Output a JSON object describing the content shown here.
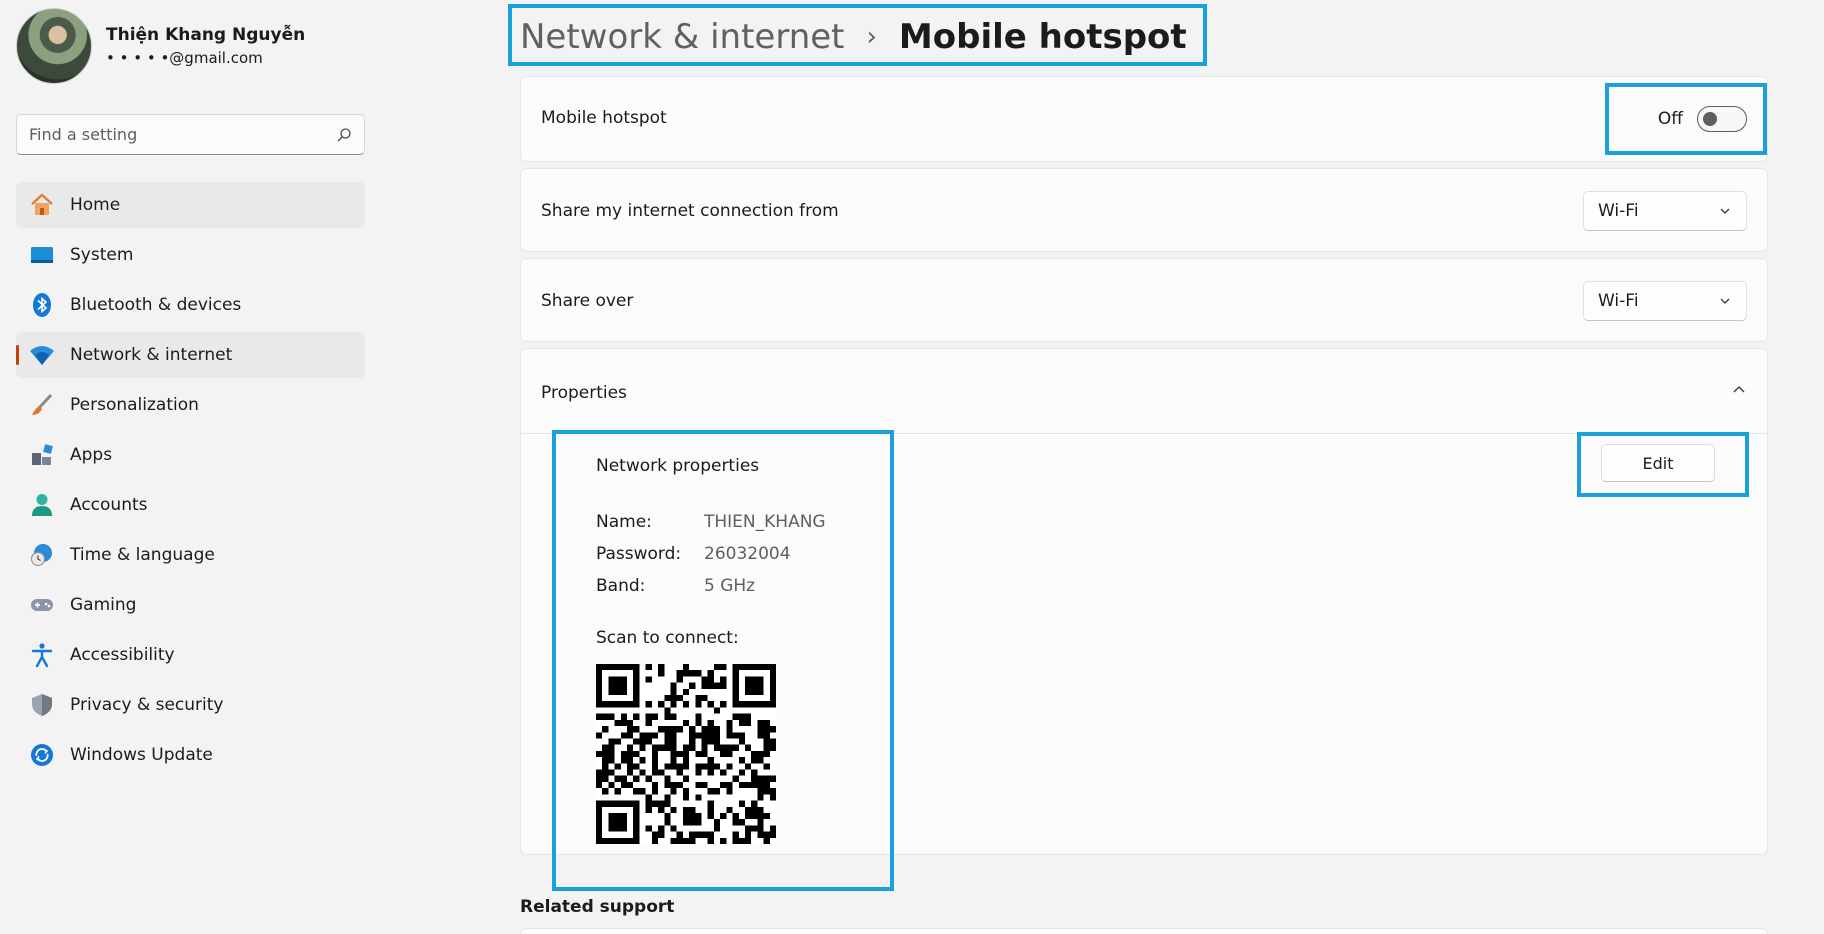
{
  "user": {
    "name": "Thiện Khang Nguyễn",
    "email": "•  •  •  •  •@gmail.com"
  },
  "search": {
    "placeholder": "Find a setting"
  },
  "sidebar": {
    "items": [
      {
        "label": "Home",
        "icon": "home-icon"
      },
      {
        "label": "System",
        "icon": "system-icon"
      },
      {
        "label": "Bluetooth & devices",
        "icon": "bluetooth-icon"
      },
      {
        "label": "Network & internet",
        "icon": "wifi-icon"
      },
      {
        "label": "Personalization",
        "icon": "brush-icon"
      },
      {
        "label": "Apps",
        "icon": "apps-icon"
      },
      {
        "label": "Accounts",
        "icon": "person-icon"
      },
      {
        "label": "Time & language",
        "icon": "globe-clock-icon"
      },
      {
        "label": "Gaming",
        "icon": "gamepad-icon"
      },
      {
        "label": "Accessibility",
        "icon": "accessibility-icon"
      },
      {
        "label": "Privacy & security",
        "icon": "shield-icon"
      },
      {
        "label": "Windows Update",
        "icon": "update-icon"
      }
    ]
  },
  "breadcrumb": {
    "parent": "Network & internet",
    "separator": "›",
    "current": "Mobile hotspot"
  },
  "hotspot": {
    "label": "Mobile hotspot",
    "state_label": "Off",
    "enabled": false
  },
  "share_from": {
    "label": "Share my internet connection from",
    "value": "Wi-Fi"
  },
  "share_over": {
    "label": "Share over",
    "value": "Wi-Fi"
  },
  "properties": {
    "label": "Properties",
    "network_title": "Network properties",
    "name_key": "Name:",
    "name_value": "THIEN_KHANG",
    "password_key": "Password:",
    "password_value": "26032004",
    "band_key": "Band:",
    "band_value": "5 GHz",
    "scan_label": "Scan to connect:",
    "edit_label": "Edit"
  },
  "related": {
    "title": "Related support"
  },
  "colors": {
    "accent_highlight": "#1aa1dc",
    "selection_indicator": "#c2410c"
  }
}
